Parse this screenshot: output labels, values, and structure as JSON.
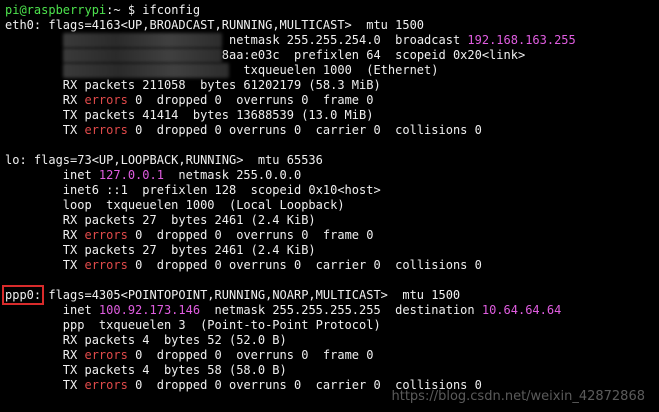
{
  "prompt": {
    "user_host": "pi@raspberrypi",
    "sep": ":~ $",
    "command": "ifconfig"
  },
  "eth0": {
    "name": "eth0:",
    "flags": " flags=4163<UP,BROADCAST,RUNNING,MULTICAST>  mtu 1500",
    "inet_rest": " netmask 255.255.254.0  broadcast ",
    "broadcast": "192.168.163.255",
    "inet6_rest": "8aa:e03c  prefixlen 64  scopeid 0x20<link>",
    "ether_rest": "  txqueuelen 1000  (Ethernet)",
    "rx_packets": "RX packets 211058  bytes 61202179 (58.3 MiB)",
    "rx_errors_word": "errors",
    "rx_errors_rest": " 0  dropped 0  overruns 0  frame 0",
    "tx_packets": "TX packets 41414  bytes 13688539 (13.0 MiB)",
    "tx_errors_word": "errors",
    "tx_errors_rest": " 0  dropped 0 overruns 0  carrier 0  collisions 0"
  },
  "lo": {
    "flags": "lo: flags=73<UP,LOOPBACK,RUNNING>  mtu 65536",
    "inet_label": "inet ",
    "inet_addr": "127.0.0.1",
    "inet_rest": "  netmask 255.0.0.0",
    "inet6": "inet6 ::1  prefixlen 128  scopeid 0x10<host>",
    "loop": "loop  txqueuelen 1000  (Local Loopback)",
    "rx_packets": "RX packets 27  bytes 2461 (2.4 KiB)",
    "rx_errors_word": "errors",
    "rx_errors_rest": " 0  dropped 0  overruns 0  frame 0",
    "tx_packets": "TX packets 27  bytes 2461 (2.4 KiB)",
    "tx_errors_word": "errors",
    "tx_errors_rest": " 0  dropped 0 overruns 0  carrier 0  collisions 0"
  },
  "ppp0": {
    "name": "ppp0:",
    "flags": " flags=4305<POINTOPOINT,RUNNING,NOARP,MULTICAST>  mtu 1500",
    "inet_label": "inet ",
    "inet_addr": "100.92.173.146",
    "inet_mid": "  netmask 255.255.255.255  destination ",
    "destination": "10.64.64.64",
    "ppp": "ppp  txqueuelen 3  (Point-to-Point Protocol)",
    "rx_packets": "RX packets 4  bytes 52 (52.0 B)",
    "rx_errors_word": "errors",
    "rx_errors_rest": " 0  dropped 0  overruns 0  frame 0",
    "tx_packets": "TX packets 4  bytes 58 (58.0 B)",
    "tx_errors_word": "errors",
    "tx_errors_rest": " 0  dropped 0 overruns 0  carrier 0  collisions 0"
  },
  "watermark": "https://blog.csdn.net/weixin_42872868",
  "colors": {
    "prompt": "#4de24d",
    "address": "#e05de0",
    "errors": "#e04a4a",
    "highlight_box": "#d92b2b"
  }
}
